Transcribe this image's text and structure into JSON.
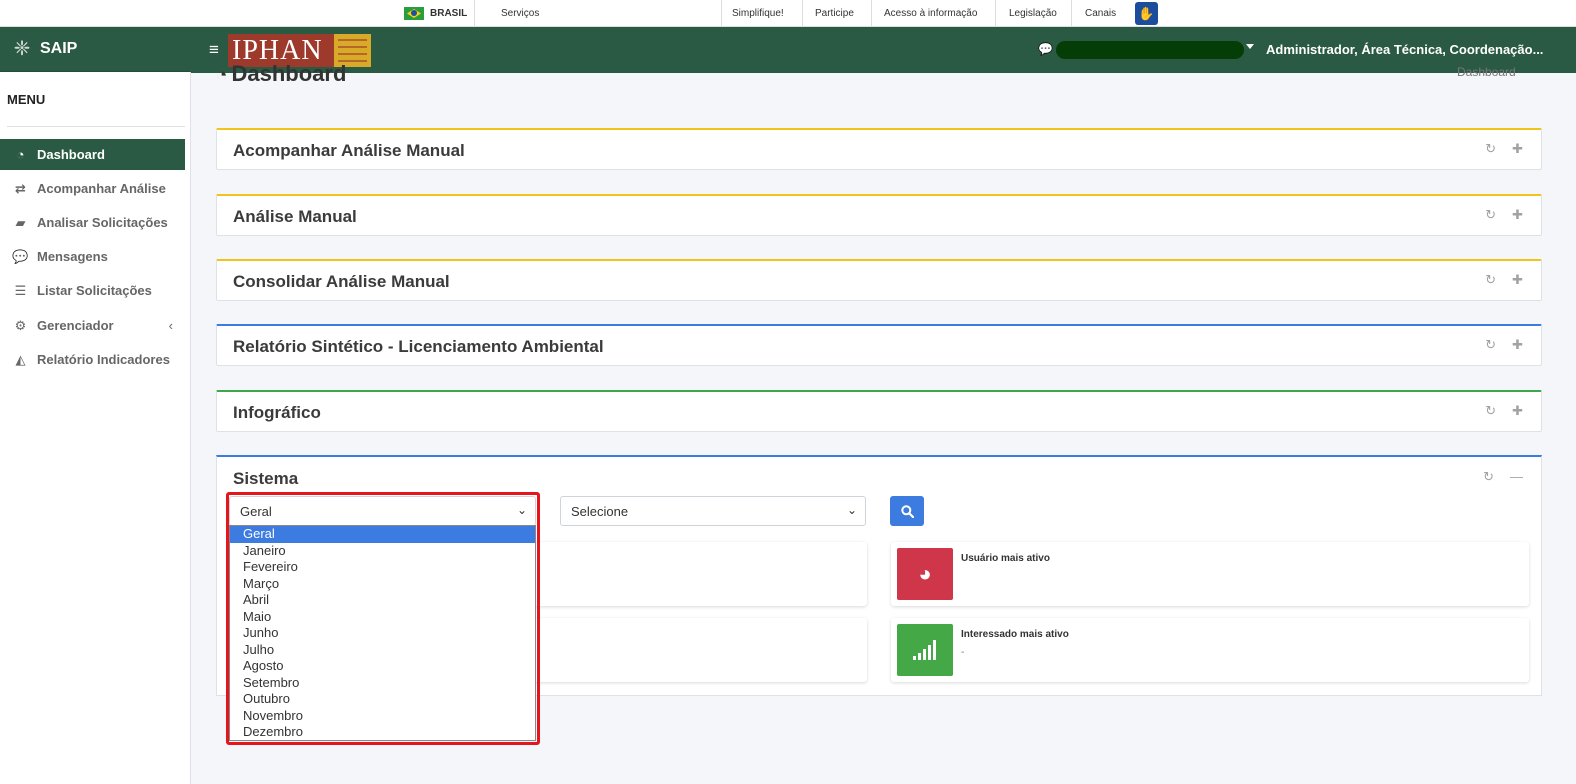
{
  "govbar": {
    "country": "BRASIL",
    "links": [
      "Serviços",
      "Simplifique!",
      "Participe",
      "Acesso à informação",
      "Legislação",
      "Canais"
    ]
  },
  "brand": {
    "name": "SAIP"
  },
  "header": {
    "logo_text": "IPHAN",
    "user": "Administrador, Área Técnica, Coordenação..."
  },
  "sidebar": {
    "title": "MENU",
    "items": [
      {
        "label": "Dashboard",
        "icon": "dashboard-icon"
      },
      {
        "label": "Acompanhar Análise",
        "icon": "exchange-icon"
      },
      {
        "label": "Analisar Solicitações",
        "icon": "book-icon"
      },
      {
        "label": "Mensagens",
        "icon": "comments-icon"
      },
      {
        "label": "Listar Solicitações",
        "icon": "list-icon"
      },
      {
        "label": "Gerenciador",
        "icon": "gears-icon"
      },
      {
        "label": "Relatório Indicadores",
        "icon": "area-chart-icon"
      }
    ]
  },
  "page": {
    "title": "Dashboard",
    "breadcrumb": "Dashboard"
  },
  "cards": [
    {
      "title": "Acompanhar Análise Manual"
    },
    {
      "title": "Análise Manual"
    },
    {
      "title": "Consolidar Análise Manual"
    },
    {
      "title": "Relatório Sintético - Licenciamento Ambiental"
    },
    {
      "title": "Infográfico"
    }
  ],
  "sistema": {
    "title": "Sistema",
    "period_select": {
      "value": "Geral",
      "options": [
        "Geral",
        "Janeiro",
        "Fevereiro",
        "Março",
        "Abril",
        "Maio",
        "Junho",
        "Julho",
        "Agosto",
        "Setembro",
        "Outubro",
        "Novembro",
        "Dezembro"
      ]
    },
    "second_select": {
      "value": "Selecione"
    },
    "boxes": [
      {
        "label": "Usuário mais ativo",
        "value": "",
        "color": "#d0364a",
        "icon": "tachometer-icon"
      },
      {
        "label": "Interessado mais ativo",
        "value": "-",
        "color": "#43a845",
        "icon": "signal-icon"
      }
    ]
  },
  "colors": {
    "brand_green": "#2b5a44",
    "accent_blue": "#3c7be0",
    "card_yellow": "#f0c419",
    "highlight_red": "#e8141c"
  }
}
